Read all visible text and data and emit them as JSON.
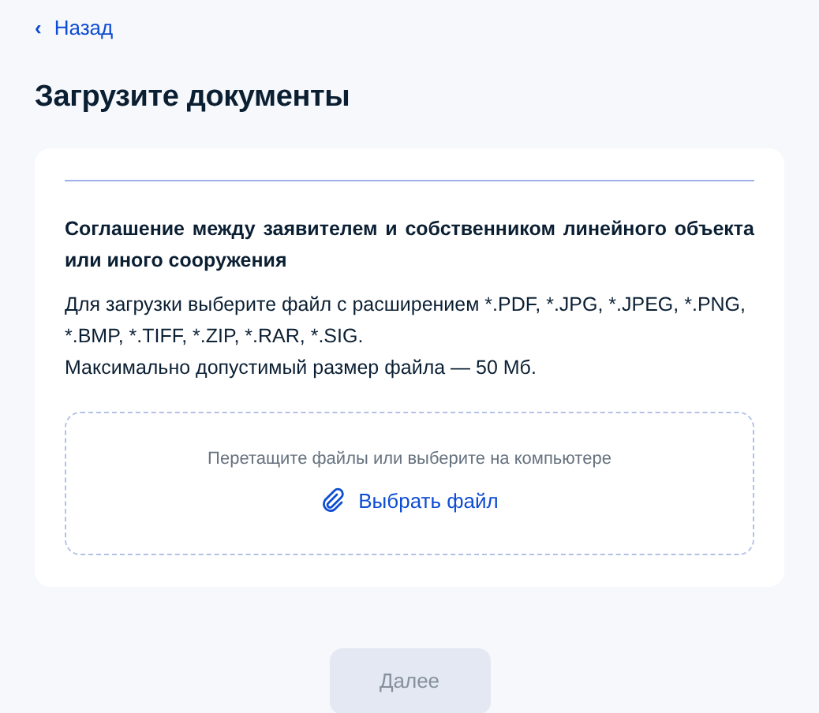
{
  "back_link": {
    "icon": "‹",
    "label": "Назад"
  },
  "title": "Загрузите документы",
  "document": {
    "title": "Соглашение между заявителем и собственником линейного объекта или иного сооружения",
    "formats": "Для загрузки выберите файл с расширением *.PDF, *.JPG, *.JPEG, *.PNG, *.BMP, *.TIFF, *.ZIP, *.RAR, *.SIG.",
    "size_limit": "Максимально допустимый размер файла — 50 Мб.",
    "dropzone": {
      "hint": "Перетащите файлы или выберите на компьютере",
      "button": "Выбрать файл"
    }
  },
  "next_button": {
    "label": "Далее",
    "disabled": true
  }
}
